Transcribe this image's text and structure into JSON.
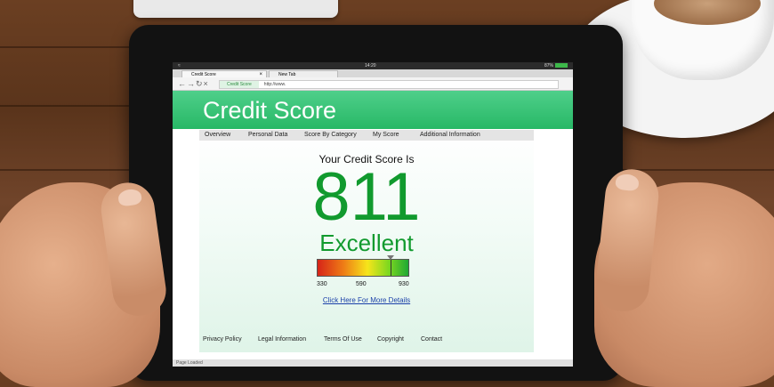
{
  "browser": {
    "status_time": "14:20",
    "battery_pct": "87%",
    "tabs": [
      {
        "label": "Credit Score"
      },
      {
        "label": "New Tab"
      }
    ],
    "address_active": "Credit Score",
    "address_url": "http://www."
  },
  "page": {
    "banner_title": "Credit Score",
    "menu": [
      "Overview",
      "Personal Data",
      "Score By Category",
      "My Score",
      "Additional Information"
    ],
    "score_label": "Your Credit Score Is",
    "score_value": "811",
    "rating": "Excellent",
    "gauge": {
      "min": "330",
      "mid": "590",
      "max": "930",
      "value_fraction": 0.8
    },
    "details_link": "Click Here For More Details",
    "footer": [
      "Privacy Policy",
      "Legal Information",
      "Terms Of Use",
      "Copyright",
      "Contact"
    ],
    "page_status": "Page Loaded"
  },
  "colors": {
    "accent_green": "#27b866",
    "score_green": "#119a2e"
  }
}
